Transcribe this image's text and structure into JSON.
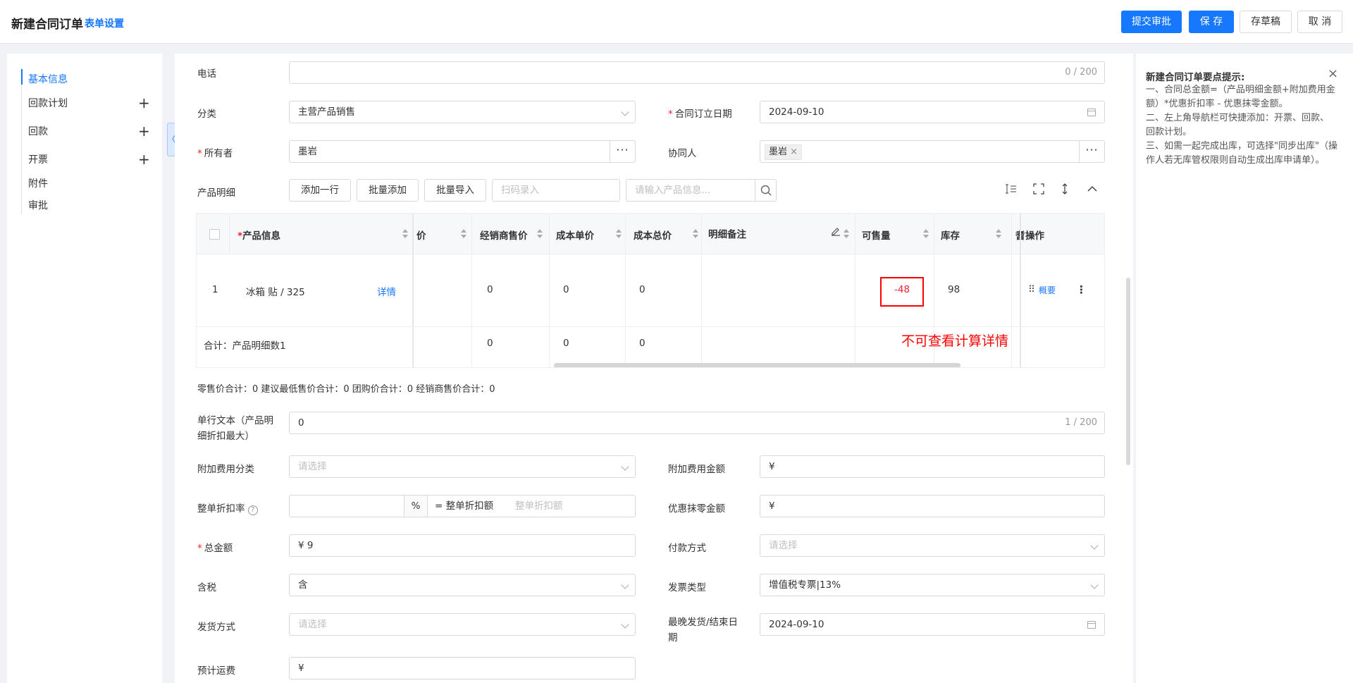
{
  "header": {
    "title": "新建合同订单",
    "settings_link": "表单设置",
    "submit": "提交审批",
    "save": "保 存",
    "draft": "存草稿",
    "cancel": "取 消"
  },
  "sidebar": {
    "items": [
      {
        "label": "基本信息",
        "active": true
      },
      {
        "label": "回款计划",
        "add": "+"
      },
      {
        "label": "回款",
        "add": "+"
      },
      {
        "label": "开票",
        "add": "+"
      },
      {
        "label": "附件"
      },
      {
        "label": "审批"
      }
    ],
    "collapse": "〈"
  },
  "form": {
    "phone": {
      "label": "电话",
      "count": "0 / 200"
    },
    "category": {
      "label": "分类",
      "value": "主营产品销售"
    },
    "sign_date": {
      "label": "合同订立日期",
      "value": "2024-09-10"
    },
    "owner": {
      "label": "所有者",
      "value": "墨岩",
      "more": "···"
    },
    "collaborator": {
      "label": "协同人",
      "tag": "墨岩",
      "tag_close": "×",
      "more": "···"
    },
    "required_mark": "*",
    "product_detail": {
      "label": "产品明细",
      "add_row": "添加一行",
      "bulk_add": "批量添加",
      "bulk_import": "批量导入",
      "scan_placeholder": "扫码录入",
      "search_placeholder": "请输入产品信息..."
    },
    "summary_line": "零售价合计：0  建议最低售价合计：0  团购价合计：0  经销商售价合计：0",
    "single_text": {
      "label_line1": "单行文本（产品明",
      "label_line2": "细折扣最大）",
      "value": "0",
      "count": "1 / 200"
    },
    "extra_fee_category": {
      "label": "附加费用分类",
      "placeholder": "请选择"
    },
    "extra_fee_amount": {
      "label": "附加费用金额",
      "value": "¥"
    },
    "discount_rate": {
      "label": "整单折扣率",
      "help": "?",
      "unit": "%",
      "eq": "= 整单折扣额",
      "placeholder": "整单折扣额"
    },
    "rounding": {
      "label": "优惠抹零金额",
      "value": "¥"
    },
    "total": {
      "label": "总金额",
      "value": "¥ 9"
    },
    "payment": {
      "label": "付款方式",
      "placeholder": "请选择"
    },
    "tax": {
      "label": "含税",
      "value": "含"
    },
    "invoice_type": {
      "label": "发票类型",
      "value": "增值税专票|13%"
    },
    "shipping": {
      "label": "发货方式",
      "placeholder": "请选择"
    },
    "latest_ship": {
      "label_line1": "最晚发货/结束日",
      "label_line2": "期",
      "value": "2024-09-10"
    },
    "freight": {
      "label": "预计运费",
      "value": "¥"
    }
  },
  "table": {
    "headers": {
      "product": "产品信息",
      "price_tail": "价",
      "dealer_price": "经销商售价",
      "cost_unit": "成本单价",
      "cost_total": "成本总价",
      "remark": "明细备注",
      "sellable": "可售量",
      "stock": "库存",
      "cut": "耆",
      "ops": "操作"
    },
    "rows": [
      {
        "index": "1",
        "product": "冰箱 贴 / 325",
        "detail": "详情",
        "dealer_price": "0",
        "cost_unit": "0",
        "cost_total": "0",
        "sellable": "-48",
        "stock": "98",
        "drag": "⠿",
        "ops_link": "概要",
        "ops_more": "⋮"
      }
    ],
    "total_row": {
      "label": "合计：产品明细数1",
      "dealer_price": "0",
      "cost_unit": "0",
      "cost_total": "0"
    },
    "annotation": "不可查看计算详情"
  },
  "tips": {
    "title": "新建合同订单要点提示:",
    "close": "×",
    "lines": [
      "一、合同总金额=（产品明细金额+附加费用金额）*优惠折扣率 - 优惠抹零金额。",
      "二、左上角导航栏可快捷添加：开票、回款、回款计划。",
      "三、如需一起完成出库，可选择\"同步出库\"（操作人若无库管权限则自动生成出库申请单）。"
    ]
  },
  "colors": {
    "primary": "#1677ff",
    "danger": "#f5222d",
    "annotation": "#ff0000"
  }
}
